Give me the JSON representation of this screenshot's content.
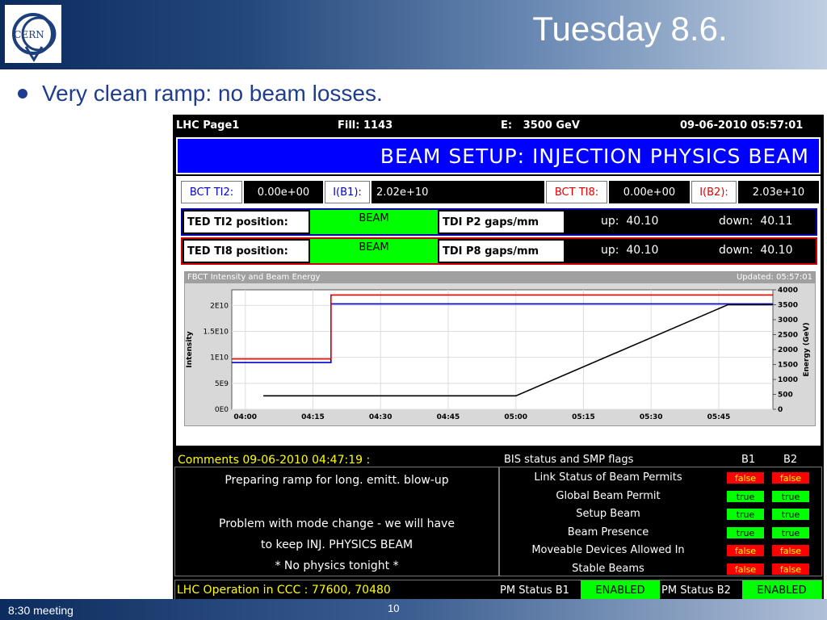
{
  "slide": {
    "title": "Tuesday 8.6.",
    "bullet": "Very clean ramp: no beam losses.",
    "footer_left": "8:30 meeting",
    "page_number": "10",
    "logo_text": "CERN"
  },
  "screen": {
    "header": {
      "page": "LHC Page1",
      "fill": "Fill: 1143",
      "energy": "E:   3500 GeV",
      "datetime": "09-06-2010 05:57:01"
    },
    "banner": "BEAM SETUP: INJECTION PHYSICS BEAM",
    "bct": {
      "ti2_label": "BCT TI2:",
      "ti2_value": "0.00e+00",
      "ib1_label": "I(B1):",
      "ib1_value": "2.02e+10",
      "ti8_label": "BCT TI8:",
      "ti8_value": "0.00e+00",
      "ib2_label": "I(B2):",
      "ib2_value": "2.03e+10"
    },
    "ted": [
      {
        "label": "TED TI2 position:",
        "state": "BEAM",
        "tdi_label": "TDI P2 gaps/mm",
        "up": "up:  40.10",
        "down": "down:  40.11"
      },
      {
        "label": "TED TI8 position:",
        "state": "BEAM",
        "tdi_label": "TDI P8 gaps/mm",
        "up": "up:  40.10",
        "down": "down:  40.10"
      }
    ],
    "comments": {
      "label": "Comments 09-06-2010 04:47:19 :",
      "lines": [
        "Preparing ramp for long. emitt. blow-up",
        "",
        "Problem with mode change - we will have",
        "to keep INJ. PHYSICS BEAM",
        "* No physics tonight *"
      ]
    },
    "bis": {
      "title": "BIS status and SMP flags",
      "b1": "B1",
      "b2": "B2",
      "rows": [
        {
          "label": "Link Status of Beam Permits",
          "b1": "false",
          "b2": "false"
        },
        {
          "label": "Global Beam Permit",
          "b1": "true",
          "b2": "true"
        },
        {
          "label": "Setup Beam",
          "b1": "true",
          "b2": "true"
        },
        {
          "label": "Beam Presence",
          "b1": "true",
          "b2": "true"
        },
        {
          "label": "Moveable Devices Allowed In",
          "b1": "false",
          "b2": "false"
        },
        {
          "label": "Stable Beams",
          "b1": "false",
          "b2": "false"
        }
      ]
    },
    "bottom": {
      "ops": "LHC Operation in CCC : 77600, 70480",
      "pm_b1_label": "PM Status B1",
      "pm_b1_value": "ENABLED",
      "pm_b2_label": "PM Status B2",
      "pm_b2_value": "ENABLED"
    }
  },
  "colors": {
    "banner": "#0000ff",
    "beam_green": "#00ff00",
    "false_red": "#ff0000",
    "b1_line": "#0000cc",
    "b2_line": "#e00000",
    "energy_line": "#000000"
  },
  "chart_data": {
    "type": "line",
    "title": "FBCT Intensity and Beam Energy",
    "updated": "Updated: 05:57:01",
    "ylabel": "Intensity",
    "y2label": "Energy (GeV)",
    "x_ticks": [
      "04:00",
      "04:15",
      "04:30",
      "04:45",
      "05:00",
      "05:15",
      "05:30",
      "05:45"
    ],
    "y_ticks": [
      "0E0",
      "5E9",
      "1E10",
      "1.5E10",
      "2E10"
    ],
    "y2_ticks": [
      "0",
      "500",
      "1000",
      "1500",
      "2000",
      "2500",
      "3000",
      "3500",
      "4000"
    ],
    "xlim": [
      "03:57",
      "05:57"
    ],
    "ylim": [
      0,
      23000000000.0
    ],
    "y2lim": [
      0,
      4000
    ],
    "grid": true,
    "series": [
      {
        "axis": "y",
        "x": [
          "03:57",
          "04:19",
          "04:19",
          "05:57"
        ],
        "values": [
          9000000000.0,
          9000000000.0,
          20300000000.0,
          20300000000.0
        ]
      },
      {
        "axis": "y",
        "x": [
          "03:57",
          "04:19",
          "04:19",
          "05:57"
        ],
        "values": [
          9700000000.0,
          9700000000.0,
          22000000000.0,
          22000000000.0
        ]
      },
      {
        "axis": "y2",
        "x": [
          "04:04",
          "05:00",
          "05:47",
          "05:57"
        ],
        "values": [
          450,
          450,
          3500,
          3500
        ]
      }
    ]
  }
}
